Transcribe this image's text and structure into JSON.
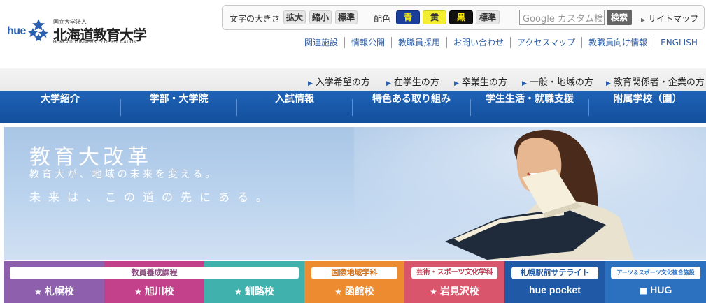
{
  "header": {
    "logo": {
      "hue": "hue",
      "corporation": "国立大学法人",
      "name": "北海道教育大学",
      "name_en": "HOKKAIDO UNIVERSITY OF EDUCATION"
    },
    "text_size": {
      "label": "文字の大きさ",
      "enlarge": "拡大",
      "shrink": "縮小",
      "standard": "標準"
    },
    "color_scheme": {
      "label": "配色",
      "blue": "青",
      "yellow": "黄",
      "black": "黒",
      "standard": "標準"
    },
    "search": {
      "placeholder": "Google カスタム検索",
      "button": "検索"
    },
    "sitemap": "サイトマップ",
    "links": [
      "関連施設",
      "情報公開",
      "教職員採用",
      "お問い合わせ",
      "アクセスマップ",
      "教職員向け情報",
      "ENGLISH"
    ]
  },
  "audience": [
    "入学希望の方",
    "在学生の方",
    "卒業生の方",
    "一般・地域の方",
    "教育関係者・企業の方"
  ],
  "main_nav": [
    "大学紹介",
    "学部・大学院",
    "入試情報",
    "特色ある取り組み",
    "学生生活・就職支援",
    "附属学校（園）"
  ],
  "hero": {
    "title": "教育大改革",
    "subtitle1": "教育大が、地域の未来を変える。",
    "subtitle2": "未来は、この道の先にある。"
  },
  "campus": {
    "teacher_training_label": "教員養成課程",
    "sapporo": "札幌校",
    "asahikawa": "旭川校",
    "kushiro": "釧路校",
    "hakodate_label": "国際地域学科",
    "hakodate": "函館校",
    "iwamizawa_label": "芸術・スポーツ文化学科",
    "iwamizawa": "岩見沢校",
    "satellite_label": "札幌駅前サテライト",
    "satellite": "hue pocket",
    "hug_label": "アーツ＆スポーツ文化複合施設",
    "hug": "HUG"
  },
  "colors": {
    "nav_blue": "#1a5aab",
    "sapporo": "#8e5fad",
    "asahikawa": "#c2418a",
    "kushiro": "#41b1ad",
    "hakodate": "#ec8b2f",
    "iwamizawa": "#d9556b",
    "satellite": "#205aa6",
    "hug": "#2c70c0"
  }
}
